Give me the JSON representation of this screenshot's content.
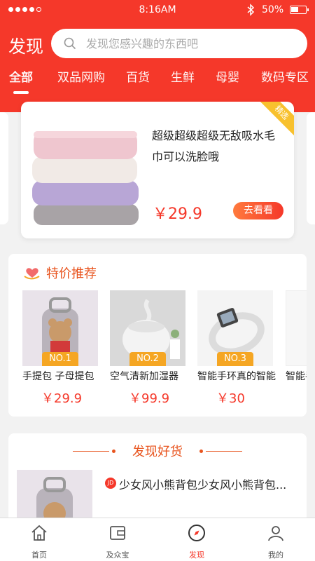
{
  "status": {
    "time": "8:16AM",
    "battery": "50%"
  },
  "header": {
    "title": "发现",
    "search_placeholder": "发现您感兴趣的东西吧"
  },
  "tabs": [
    {
      "label": "全部",
      "active": true
    },
    {
      "label": "双品网购"
    },
    {
      "label": "百货"
    },
    {
      "label": "生鲜"
    },
    {
      "label": "母婴"
    },
    {
      "label": "数码专区"
    }
  ],
  "featured": {
    "ribbon": "精选",
    "description": "超级超级超级无敌吸水毛巾可以洗脸哦",
    "price": "￥29.9",
    "button": "去看看"
  },
  "specials": {
    "title": "特价推荐",
    "items": [
      {
        "rank": "NO.1",
        "name": "手提包 子母提包",
        "price": "￥29.9"
      },
      {
        "rank": "NO.2",
        "name": "空气清新加湿器",
        "price": "￥99.9"
      },
      {
        "rank": "NO.3",
        "name": "智能手环真的智能",
        "price": "￥30"
      },
      {
        "rank": "",
        "name": "智能手",
        "price": ""
      }
    ]
  },
  "discover": {
    "title": "发现好货",
    "item": {
      "badge": "JD",
      "title": "少女风小熊背包少女风小熊背包..."
    }
  },
  "tabbar": [
    {
      "label": "首页",
      "icon": "home-icon"
    },
    {
      "label": "及众宝",
      "icon": "wallet-icon"
    },
    {
      "label": "发现",
      "icon": "compass-icon",
      "active": true
    },
    {
      "label": "我的",
      "icon": "user-icon"
    }
  ],
  "colors": {
    "brand": "#f5382a",
    "accent": "#e8541e",
    "rank": "#f5a623"
  }
}
